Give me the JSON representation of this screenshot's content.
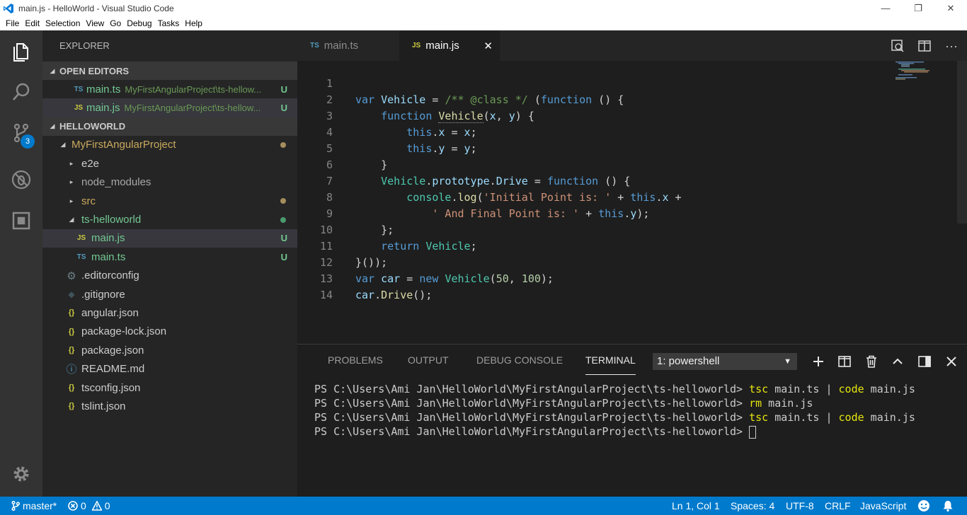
{
  "window": {
    "title": "main.js - HelloWorld - Visual Studio Code",
    "minimize_glyph": "—",
    "restore_glyph": "❐",
    "close_glyph": "✕"
  },
  "menubar": [
    "File",
    "Edit",
    "Selection",
    "View",
    "Go",
    "Debug",
    "Tasks",
    "Help"
  ],
  "activitybar": {
    "scm_badge": "3"
  },
  "sidebar": {
    "title": "EXPLORER",
    "open_editors_label": "OPEN EDITORS",
    "open_editors": [
      {
        "icon": "TS",
        "name": "main.ts",
        "path": "MyFirstAngularProject\\ts-hellow...",
        "status": "U"
      },
      {
        "icon": "JS",
        "name": "main.js",
        "path": "MyFirstAngularProject\\ts-hellow...",
        "status": "U"
      }
    ],
    "workspace_label": "HELLOWORLD",
    "tree": {
      "root": "MyFirstAngularProject",
      "e2e": "e2e",
      "node_modules": "node_modules",
      "src": "src",
      "ts_helloworld": "ts-helloworld",
      "main_js": {
        "icon": "JS",
        "name": "main.js",
        "status": "U"
      },
      "main_ts": {
        "icon": "TS",
        "name": "main.ts",
        "status": "U"
      },
      "editorconfig": ".editorconfig",
      "gitignore": ".gitignore",
      "angular_json": "angular.json",
      "package_lock": "package-lock.json",
      "package_json": "package.json",
      "readme": "README.md",
      "tsconfig": "tsconfig.json",
      "tslint": "tslint.json",
      "json_icon": "{}",
      "info_icon": "ⓘ",
      "gear_icon": "⚙",
      "diamond_icon": "◆"
    }
  },
  "tabs": [
    {
      "icon": "TS",
      "label": "main.ts"
    },
    {
      "icon": "JS",
      "label": "main.js",
      "close": "✕"
    }
  ],
  "editor": {
    "line_numbers": [
      "1",
      "2",
      "3",
      "4",
      "5",
      "6",
      "7",
      "8",
      "9",
      "10",
      "11",
      "12",
      "13",
      "14"
    ],
    "code": {
      "l1": {
        "a": "var",
        "b": " ",
        "c": "Vehicle",
        "d": " = ",
        "e": "/** @class */",
        "f": " (",
        "g": "function",
        "h": " () {"
      },
      "l2": {
        "a": "    ",
        "b": "function",
        "c": " ",
        "d": "Vehicle",
        "e": "(",
        "f": "x",
        "g": ", ",
        "h": "y",
        "i": ") {"
      },
      "l3": {
        "a": "        ",
        "b": "this",
        "c": ".",
        "d": "x",
        "e": " = ",
        "f": "x",
        "g": ";"
      },
      "l4": {
        "a": "        ",
        "b": "this",
        "c": ".",
        "d": "y",
        "e": " = ",
        "f": "y",
        "g": ";"
      },
      "l5": {
        "a": "    }"
      },
      "l6": {
        "a": "    ",
        "b": "Vehicle",
        "c": ".",
        "d": "prototype",
        "e": ".",
        "f": "Drive",
        "g": " = ",
        "h": "function",
        "i": " () {"
      },
      "l7": {
        "a": "        ",
        "b": "console",
        "c": ".",
        "d": "log",
        "e": "(",
        "f": "'Initial Point is: '",
        "g": " + ",
        "h": "this",
        "i": ".",
        "j": "x",
        "k": " +"
      },
      "l8": {
        "a": "            ",
        "b": "' And Final Point is: '",
        "c": " + ",
        "d": "this",
        "e": ".",
        "f": "y",
        "g": ");"
      },
      "l9": {
        "a": "    };"
      },
      "l10": {
        "a": "    ",
        "b": "return",
        "c": " ",
        "d": "Vehicle",
        "e": ";"
      },
      "l11": {
        "a": "}());"
      },
      "l12": {
        "a": "var",
        "b": " ",
        "c": "car",
        "d": " = ",
        "e": "new",
        "f": " ",
        "g": "Vehicle",
        "h": "(",
        "i": "50",
        "j": ", ",
        "k": "100",
        "l": ");"
      },
      "l13": {
        "a": "car",
        "b": ".",
        "c": "Drive",
        "d": "();"
      }
    }
  },
  "panel": {
    "tabs": [
      "PROBLEMS",
      "OUTPUT",
      "DEBUG CONSOLE",
      "TERMINAL"
    ],
    "terminal_select": "1: powershell",
    "terminal": {
      "prompt": "PS C:\\Users\\Ami Jan\\HelloWorld\\MyFirstAngularProject\\ts-helloworld> ",
      "l1": {
        "c1": "tsc",
        "a1": " main.ts | ",
        "c2": "code",
        "a2": " main.js"
      },
      "l2": {
        "c1": "rm",
        "a1": " main.js"
      },
      "l3": {
        "c1": "tsc",
        "a1": " main.ts | ",
        "c2": "code",
        "a2": " main.js"
      }
    }
  },
  "statusbar": {
    "branch": "master*",
    "errors": "0",
    "warnings": "0",
    "position": "Ln 1, Col 1",
    "spaces": "Spaces: 4",
    "encoding": "UTF-8",
    "eol": "CRLF",
    "language": "JavaScript"
  },
  "colors": {
    "accent": "#007acc",
    "activitybar": "#333333",
    "sidebar": "#252526",
    "editor": "#1e1e1e"
  }
}
